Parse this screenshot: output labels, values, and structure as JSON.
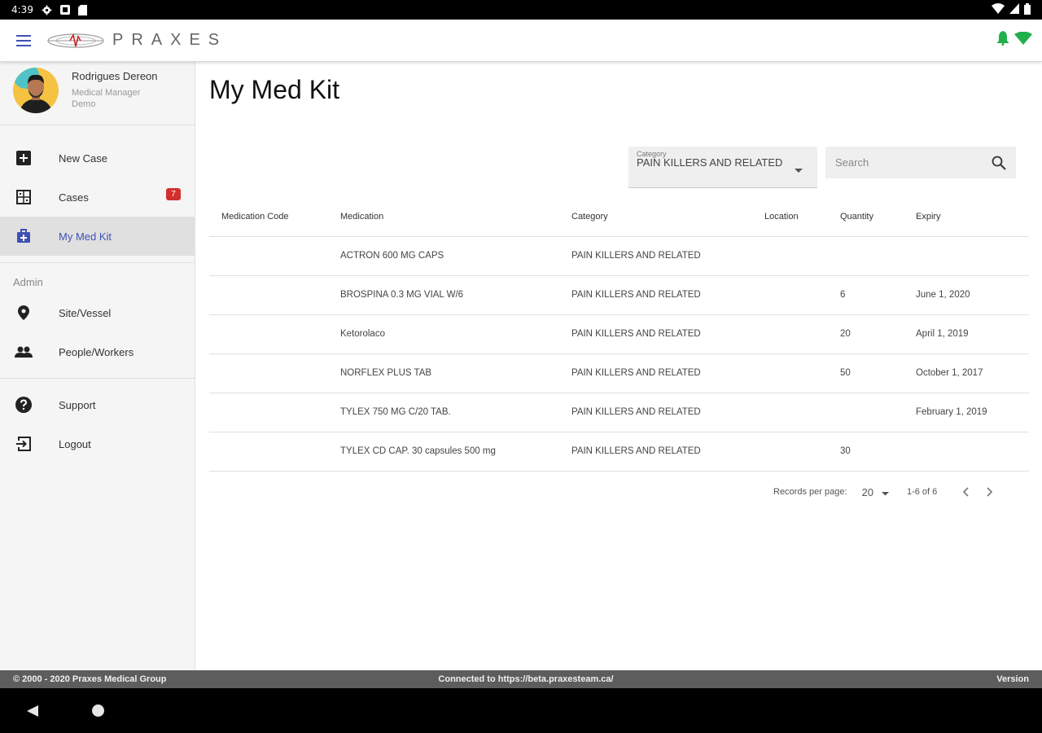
{
  "status_bar": {
    "time": "4:39"
  },
  "app": {
    "logo_text": "PRAXES"
  },
  "profile": {
    "name": "Rodrigues Dereon",
    "role": "Medical Manager",
    "company": "Demo"
  },
  "nav": {
    "items": [
      {
        "label": "New Case",
        "icon": "plus-square-icon"
      },
      {
        "label": "Cases",
        "icon": "grid-icon",
        "badge": "7"
      },
      {
        "label": "My Med Kit",
        "icon": "med-kit-icon",
        "active": true
      }
    ],
    "admin_title": "Admin",
    "admin_items": [
      {
        "label": "Site/Vessel",
        "icon": "location-pin-icon"
      },
      {
        "label": "People/Workers",
        "icon": "people-icon"
      }
    ],
    "support_items": [
      {
        "label": "Support",
        "icon": "help-icon"
      },
      {
        "label": "Logout",
        "icon": "logout-icon"
      }
    ]
  },
  "page": {
    "title": "My Med Kit"
  },
  "filter": {
    "label": "Category",
    "value": "PAIN KILLERS AND RELATED"
  },
  "search": {
    "placeholder": "Search"
  },
  "table": {
    "columns": [
      "Medication Code",
      "Medication",
      "Category",
      "Location",
      "Quantity",
      "Expiry"
    ],
    "rows": [
      [
        "",
        "ACTRON 600 MG CAPS",
        "PAIN KILLERS AND RELATED",
        "",
        "",
        ""
      ],
      [
        "",
        "BROSPINA 0.3 MG VIAL W/6",
        "PAIN KILLERS AND RELATED",
        "",
        "6",
        "June 1, 2020"
      ],
      [
        "",
        "Ketorolaco",
        "PAIN KILLERS AND RELATED",
        "",
        "20",
        "April 1, 2019"
      ],
      [
        "",
        "NORFLEX PLUS TAB",
        "PAIN KILLERS AND RELATED",
        "",
        "50",
        "October 1, 2017"
      ],
      [
        "",
        "TYLEX 750 MG C/20 TAB.",
        "PAIN KILLERS AND RELATED",
        "",
        "",
        "February 1, 2019"
      ],
      [
        "",
        "TYLEX CD CAP. 30 capsules 500 mg",
        "PAIN KILLERS AND RELATED",
        "",
        "30",
        ""
      ]
    ]
  },
  "pager": {
    "label": "Records per page:",
    "size": "20",
    "range": "1-6 of 6"
  },
  "footer": {
    "copyright": "© 2000 - 2020 Praxes Medical Group",
    "connection": "Connected to https://beta.praxesteam.ca/",
    "version": "Version"
  },
  "colors": {
    "accent": "#3f51b5",
    "badge": "#d32f2f",
    "notification": "#21b04b",
    "footer": "#5d5d5d"
  }
}
